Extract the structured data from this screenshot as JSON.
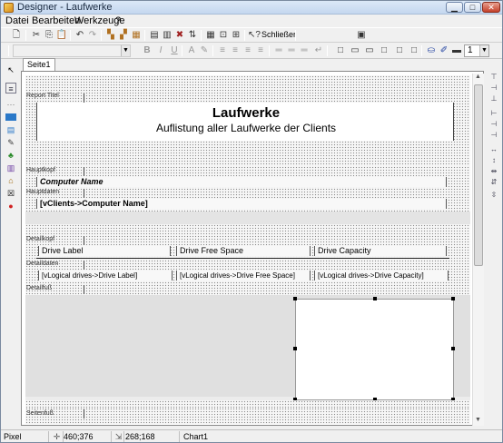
{
  "window": {
    "title": "Designer - Laufwerke",
    "controls": [
      "▁",
      "□",
      "✕"
    ]
  },
  "menu": [
    "Datei",
    "Bearbeiten",
    "Werkzeuge",
    "?"
  ],
  "toolbar1": {
    "close_label": "Schließer"
  },
  "toolbar2": {
    "line_width": "1"
  },
  "tabs": [
    "Seite1"
  ],
  "report": {
    "title_band": "Report Titel",
    "title": "Laufwerke",
    "subtitle": "Auflistung aller Laufwerke der Clients",
    "header_band": "Hauptkopf",
    "header_field": "Computer Name",
    "data_band": "Hauptdaten",
    "data_field": "[vClients->Computer Name]",
    "detail_header_band": "Detailkopf",
    "detail_headers": [
      "Drive Label",
      "Drive Free Space",
      "Drive Capacity"
    ],
    "detail_data_band": "Detaildaten",
    "detail_fields": [
      "[vLogical drives->Drive Label]",
      "[vLogical drives->Drive Free Space]",
      "[vLogical drives->Drive Capacity]"
    ],
    "detail_footer_band": "Detailfuß",
    "page_footer_band": "Seitenfuß"
  },
  "status": {
    "unit": "Pixel",
    "position": "460;376",
    "size": "268;168",
    "object": "Chart1"
  }
}
